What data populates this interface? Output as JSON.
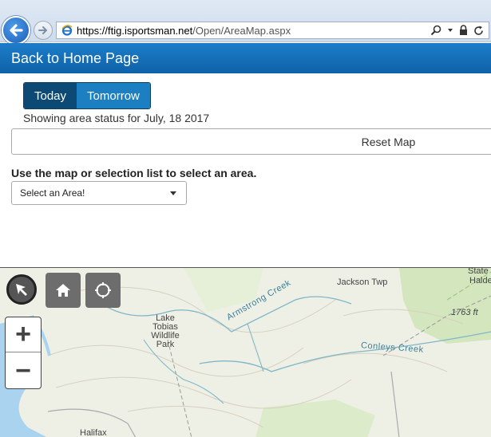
{
  "browser": {
    "url_host": "https://ftig.isportsman.net",
    "url_path": "/Open/AreaMap.aspx",
    "icons": [
      "back-arrow-icon",
      "forward-arrow-icon",
      "ie-logo-icon",
      "search-icon",
      "lock-icon",
      "refresh-icon"
    ]
  },
  "header": {
    "back_link": "Back to Home Page"
  },
  "day_toggle": {
    "today": "Today",
    "tomorrow": "Tomorrow",
    "selected": "Today"
  },
  "status_text": "Showing area status for July, 18 2017",
  "reset_label": "Reset Map",
  "instruction": "Use the map or selection list to select an area.",
  "area_select": {
    "value": "Select an Area!"
  },
  "map": {
    "labels": {
      "jackson": "Jackson Twp",
      "state": "State",
      "halde": "Halde",
      "elevation": "1763 ft",
      "lake_line1": "Lake",
      "lake_line2": "Tobias",
      "lake_line3": "Wildlife",
      "lake_line4": "Park",
      "armstrong": "Armstrong Creek",
      "conleys": "Conleys Creek",
      "halifax": "Halifax"
    },
    "zoom_in": "+",
    "zoom_out": "−"
  },
  "colors": {
    "header_blue": "#1570b8",
    "toggle_active": "#0c4a75",
    "toggle_inactive": "#1b7fc2",
    "water": "#a9d3ee",
    "forest": "#cfe3b6"
  }
}
